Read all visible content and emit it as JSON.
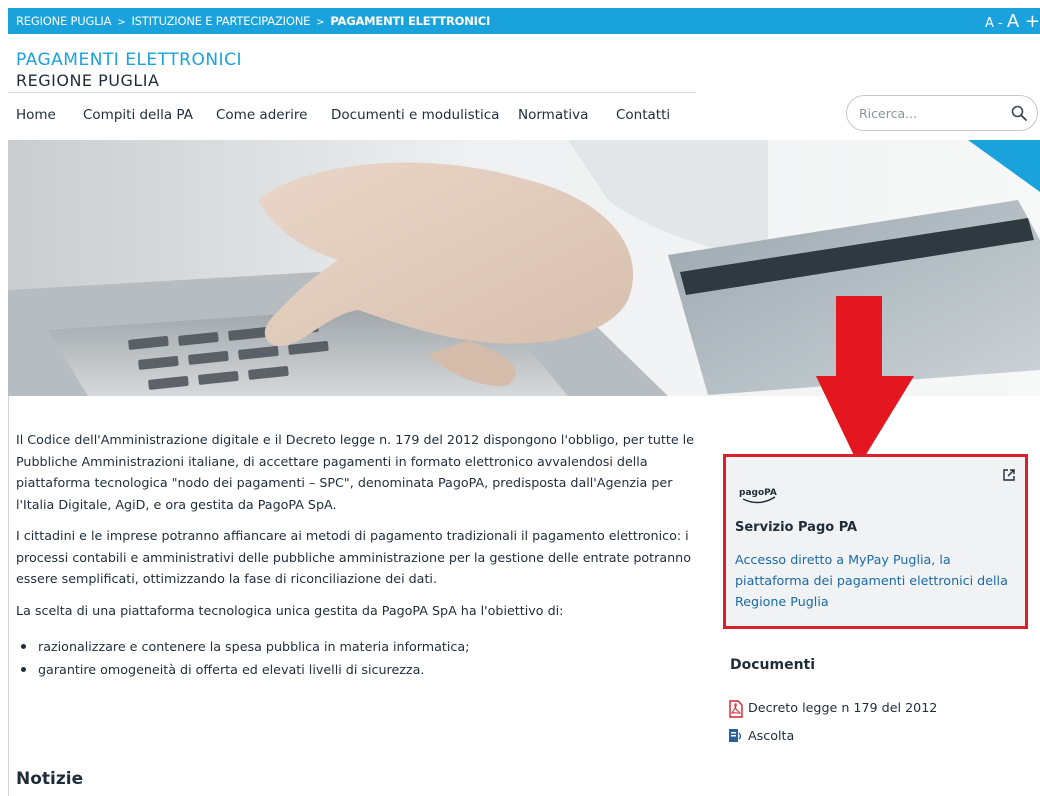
{
  "breadcrumb": {
    "items": [
      "REGIONE PUGLIA",
      "ISTITUZIONE E PARTECIPAZIONE",
      "PAGAMENTI ELETTRONICI"
    ],
    "separator": ">"
  },
  "font_size_controls": {
    "decrease": "A -",
    "increase": "A +"
  },
  "site": {
    "title": "PAGAMENTI ELETTRONICI",
    "subtitle": "REGIONE PUGLIA"
  },
  "nav": {
    "items": [
      "Home",
      "Compiti della PA",
      "Come aderire",
      "Documenti e modulistica",
      "Normativa",
      "Contatti"
    ]
  },
  "search": {
    "placeholder": "Ricerca...",
    "icon": "search-icon"
  },
  "content": {
    "paragraphs": [
      "Il Codice dell'Amministrazione digitale e il Decreto legge n. 179 del 2012 dispongono l'obbligo, per tutte le Pubbliche Amministrazioni italiane, di accettare pagamenti in formato elettronico avvalendosi della piattaforma tecnologica \"nodo dei pagamenti – SPC\", denominata PagoPA, predisposta dall'Agenzia per l'Italia Digitale, AgiD, e ora gestita da PagoPA SpA.",
      "I cittadini e le imprese potranno affiancare ai metodi di pagamento tradizionali il pagamento elettronico: i processi contabili e amministrativi delle pubbliche amministrazione per la gestione delle entrate potranno essere semplificati, ottimizzando la fase di riconciliazione dei dati.",
      "La scelta di una piattaforma tecnologica unica gestita da PagoPA SpA ha l'obiettivo di:"
    ],
    "bullets": [
      "razionalizzare e contenere la spesa pubblica in materia informatica;",
      "garantire omogeneità di offerta ed elevati livelli di sicurezza."
    ]
  },
  "news": {
    "title": "Notizie"
  },
  "service_card": {
    "logo_text": "pagoPA",
    "title": "Servizio Pago PA",
    "description": "Accesso diretto a MyPay Puglia, la piattaforma dei pagamenti elettronici della Regione Puglia",
    "highlight_color": "#d9212e"
  },
  "documents": {
    "title": "Documenti",
    "items": [
      {
        "label": "Decreto legge n 179 del 2012",
        "icon": "pdf-icon"
      },
      {
        "label": "Ascolta",
        "icon": "audio-icon"
      }
    ]
  },
  "colors": {
    "primary": "#1aa2dc",
    "accent": "#d9212e",
    "text": "#1f2d3a",
    "link": "#1a6aa8"
  }
}
